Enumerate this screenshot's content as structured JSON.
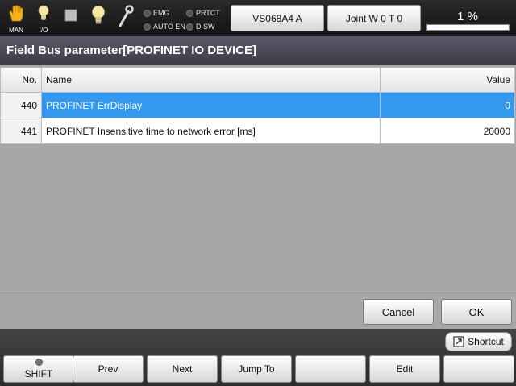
{
  "status_bar": {
    "mode_label": "MAN",
    "io_label": "I/O",
    "indicators": {
      "emg": "EMG",
      "prtct": "PRTCT",
      "auto_en": "AUTO EN",
      "dsw": "D SW"
    },
    "robot_button": "VS068A4 A",
    "coord_button": "Joint  W 0 T 0",
    "speed_text": "1 %",
    "speed_fraction": 0.01,
    "speed_bar_color": "#3b8fd8"
  },
  "title": "Field Bus parameter[PROFINET IO DEVICE]",
  "table": {
    "columns": {
      "no": "No.",
      "name": "Name",
      "value": "Value"
    },
    "rows": [
      {
        "no": "440",
        "name": "PROFINET ErrDisplay",
        "value": "0"
      },
      {
        "no": "441",
        "name": "PROFINET Insensitive time to network error [ms]",
        "value": "20000"
      }
    ],
    "selected_color": "#3398ef"
  },
  "dialog_buttons": {
    "cancel": "Cancel",
    "ok": "OK"
  },
  "shortcut_label": "Shortcut",
  "function_keys": {
    "f1": "SHIFT",
    "f2": "Prev",
    "f3": "Next",
    "f4": "Jump To",
    "f5": "",
    "f6": "Edit",
    "f7": ""
  },
  "icons": [
    "hand-icon",
    "lightbulb-icon",
    "stop-icon",
    "lightbulb-icon",
    "wrench-icon"
  ]
}
